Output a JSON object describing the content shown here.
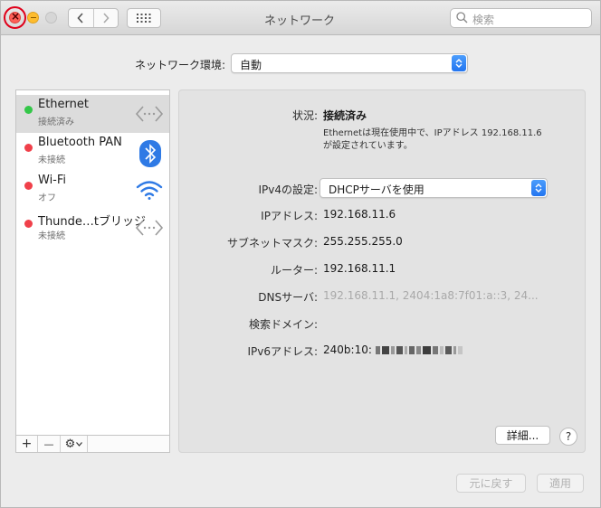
{
  "window": {
    "title": "ネットワーク"
  },
  "search": {
    "placeholder": "検索"
  },
  "location": {
    "label": "ネットワーク環境:",
    "value": "自動"
  },
  "services": [
    {
      "name": "Ethernet",
      "status": "接続済み",
      "status_color": "#34c749",
      "icon": "ethernet-arrows-icon"
    },
    {
      "name": "Bluetooth PAN",
      "status": "未接続",
      "status_color": "#f0404a",
      "icon": "bluetooth-icon"
    },
    {
      "name": "Wi-Fi",
      "status": "オフ",
      "status_color": "#f0404a",
      "icon": "wifi-icon"
    },
    {
      "name": "Thunde…tブリッジ",
      "status": "未接続",
      "status_color": "#f0404a",
      "icon": "ethernet-arrows-icon"
    }
  ],
  "sidebar_tools": {
    "add": "+",
    "remove": "—",
    "gear": "⚙"
  },
  "details": {
    "status_label": "状況:",
    "status_value": "接続済み",
    "description_line1": "Ethernetは現在使用中で、IPアドレス 192.168.11.6",
    "description_line2": "が設定されています。",
    "ipv4_label": "IPv4の設定:",
    "ipv4_value": "DHCPサーバを使用",
    "ip_label": "IPアドレス:",
    "ip_value": "192.168.11.6",
    "subnet_label": "サブネットマスク:",
    "subnet_value": "255.255.255.0",
    "router_label": "ルーター:",
    "router_value": "192.168.11.1",
    "dns_label": "DNSサーバ:",
    "dns_value": "192.168.11.1, 2404:1a8:7f01:a::3, 24...",
    "domain_label": "検索ドメイン:",
    "domain_value": "",
    "ipv6_label": "IPv6アドレス:",
    "ipv6_value": "240b:10:"
  },
  "buttons": {
    "advanced": "詳細...",
    "help": "?",
    "revert": "元に戻す",
    "apply": "適用"
  },
  "colors": {
    "accent": "#2275f0",
    "annotation": "#e0001a"
  }
}
